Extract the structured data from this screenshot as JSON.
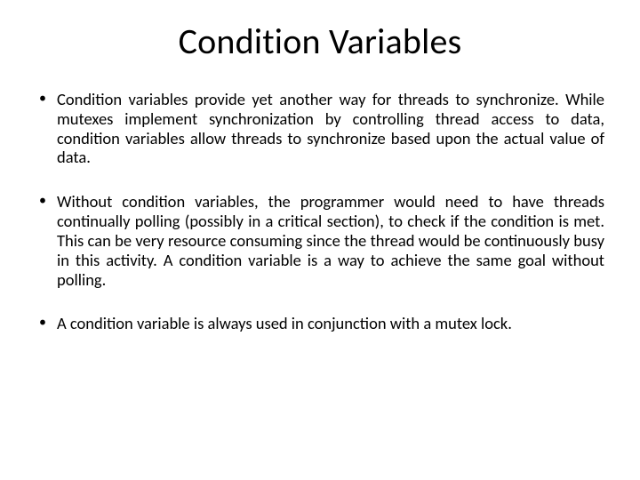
{
  "slide": {
    "title": "Condition Variables",
    "bullets": [
      "Condition variables provide yet another way for threads to synchronize. While mutexes implement synchronization by controlling thread access to data, condition variables allow threads to synchronize based upon the actual value of data.",
      "Without condition variables, the programmer would need to have threads continually polling (possibly in a critical section), to check if the condition is met. This can be very resource consuming since the thread would be continuously busy in this activity. A condition variable is a way to achieve the same goal without polling.",
      "A condition variable is always used in conjunction with a mutex lock."
    ]
  }
}
